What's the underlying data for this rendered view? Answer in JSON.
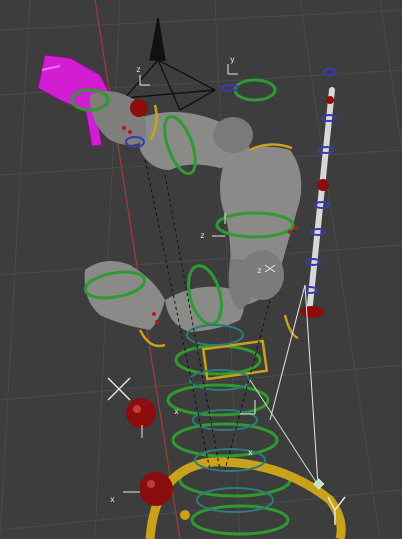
{
  "viewport": {
    "background": "#3d3d3d",
    "grid_color": "#4a4a4a",
    "axis_x_color": "#a33a3a",
    "axis_y_color": "#7a9a3a"
  },
  "colors": {
    "mesh": "#8a8a88",
    "mesh_shadow": "#5e5e5c",
    "fk_control": "#2f9a2f",
    "ik_control": "#c9a11b",
    "pole_target": "#8b0d0d",
    "stretch_rod": "#d8d8d8",
    "prop_gun": "#d21ed2",
    "constraint_line": "#e6e6e6",
    "empty_cross": "#f0f0f0",
    "bone_dot_blue": "#3a3ab5",
    "bone_dot_red": "#b21b1b",
    "selected_light": "#bde6bd"
  },
  "objects": [
    {
      "name": "hand-l",
      "icon": "hand-mesh-icon"
    },
    {
      "name": "upper-arm-r",
      "icon": "arm-mesh-icon"
    },
    {
      "name": "torso",
      "icon": "torso-mesh-icon"
    },
    {
      "name": "gun-prop",
      "icon": "gun-icon"
    },
    {
      "name": "camera-gizmo",
      "icon": "camera-frustum-icon"
    },
    {
      "name": "pole-target-upper",
      "icon": "sphere-icon"
    },
    {
      "name": "pole-target-lower",
      "icon": "sphere-icon"
    },
    {
      "name": "stretch-rod",
      "icon": "rod-icon"
    }
  ],
  "axis_labels": [
    "x",
    "y",
    "z"
  ]
}
